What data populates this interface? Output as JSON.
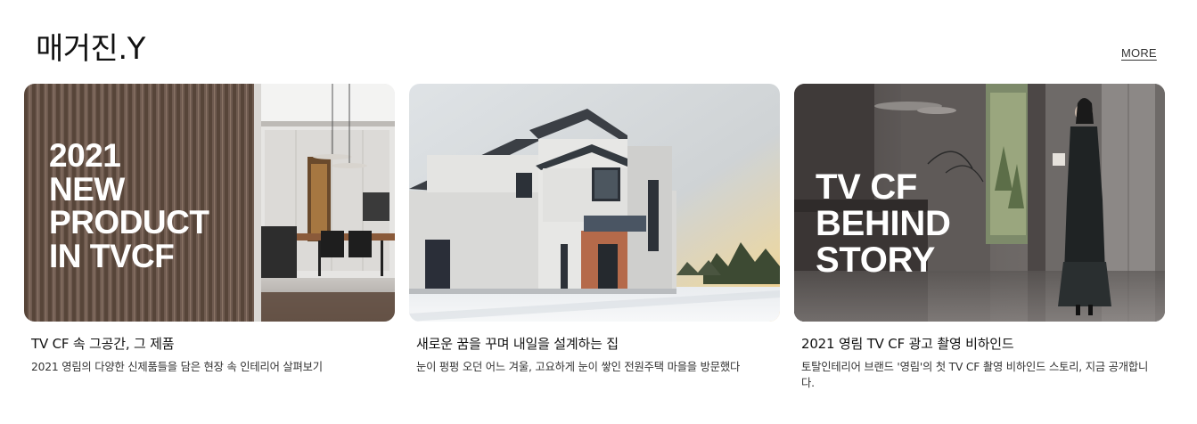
{
  "section": {
    "title": "매거진.Y",
    "more_label": "MORE"
  },
  "cards": [
    {
      "overlay_lines": [
        "2021",
        "NEW",
        "PRODUCT",
        "IN TVCF"
      ],
      "title": "TV CF 속 그공간, 그 제품",
      "description": "2021 영림의 다양한 신제품들을 담은 현장 속 인테리어 살펴보기"
    },
    {
      "overlay_lines": [],
      "title": "새로운 꿈을 꾸며 내일을 설계하는 집",
      "description": "눈이 펑펑 오던 어느 겨울, 고요하게 눈이 쌓인 전원주택 마을을 방문했다"
    },
    {
      "overlay_lines": [
        "TV CF",
        "BEHIND",
        "STORY"
      ],
      "title": "2021 영림 TV CF 광고 촬영 비하인드",
      "description": "토탈인테리어 브랜드 '영림'의 첫 TV CF 촬영 비하인드 스토리, 지금 공개합니다."
    }
  ]
}
